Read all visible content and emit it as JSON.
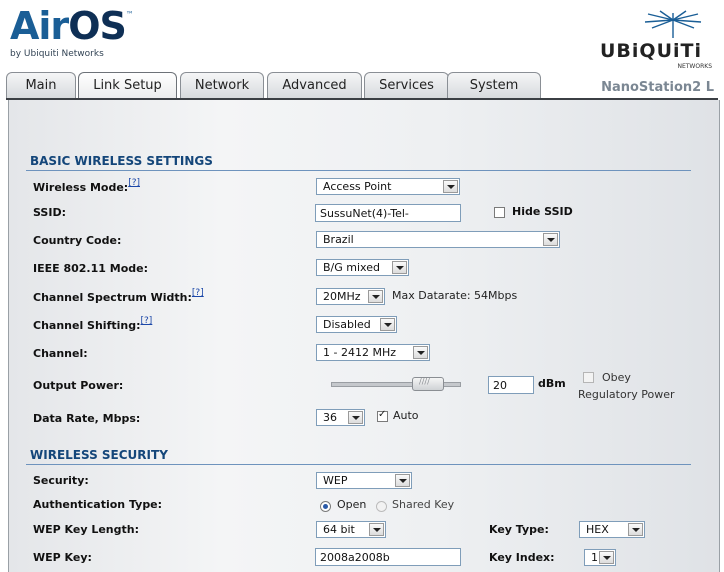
{
  "header": {
    "logo_main": "Air",
    "logo_os": "OS",
    "logo_tm": "™",
    "logo_by": "by Ubiquiti Networks",
    "brand_word": "UBiQUiTi",
    "brand_sub": "NETWORKS",
    "device_name": "NanoStation2 L"
  },
  "tabs": [
    {
      "label": "Main"
    },
    {
      "label": "Link Setup"
    },
    {
      "label": "Network"
    },
    {
      "label": "Advanced"
    },
    {
      "label": "Services"
    },
    {
      "label": "System"
    }
  ],
  "basic": {
    "title": "BASIC WIRELESS SETTINGS",
    "help": "[?]",
    "wireless_mode": {
      "label": "Wireless Mode:",
      "value": "Access Point"
    },
    "ssid": {
      "label": "SSID:",
      "value": "SussuNet(4)-Tel-",
      "hide_label": "Hide SSID",
      "hide_checked": false
    },
    "country": {
      "label": "Country Code:",
      "value": "Brazil"
    },
    "ieee": {
      "label": "IEEE 802.11 Mode:",
      "value": "B/G mixed"
    },
    "spectrum": {
      "label": "Channel Spectrum Width:",
      "value": "20MHz",
      "max_text": "Max Datarate: 54Mbps"
    },
    "shifting": {
      "label": "Channel Shifting:",
      "value": "Disabled"
    },
    "channel": {
      "label": "Channel:",
      "value": "1 - 2412 MHz"
    },
    "power": {
      "label": "Output Power:",
      "value": "20",
      "unit": "dBm",
      "obey": "Obey",
      "regulatory": "Regulatory Power",
      "level": 0.83
    },
    "rate": {
      "label": "Data Rate, Mbps:",
      "value": "36",
      "auto_label": "Auto",
      "auto_checked": true
    }
  },
  "security": {
    "title": "WIRELESS SECURITY",
    "security": {
      "label": "Security:",
      "value": "WEP"
    },
    "auth": {
      "label": "Authentication Type:",
      "open": "Open",
      "shared": "Shared Key"
    },
    "key_length": {
      "label": "WEP Key Length:",
      "value": "64 bit"
    },
    "key_type": {
      "label": "Key Type:",
      "value": "HEX"
    },
    "wep_key": {
      "label": "WEP Key:",
      "value": "2008a2008b"
    },
    "key_index": {
      "label": "Key Index:",
      "value": "1"
    }
  }
}
